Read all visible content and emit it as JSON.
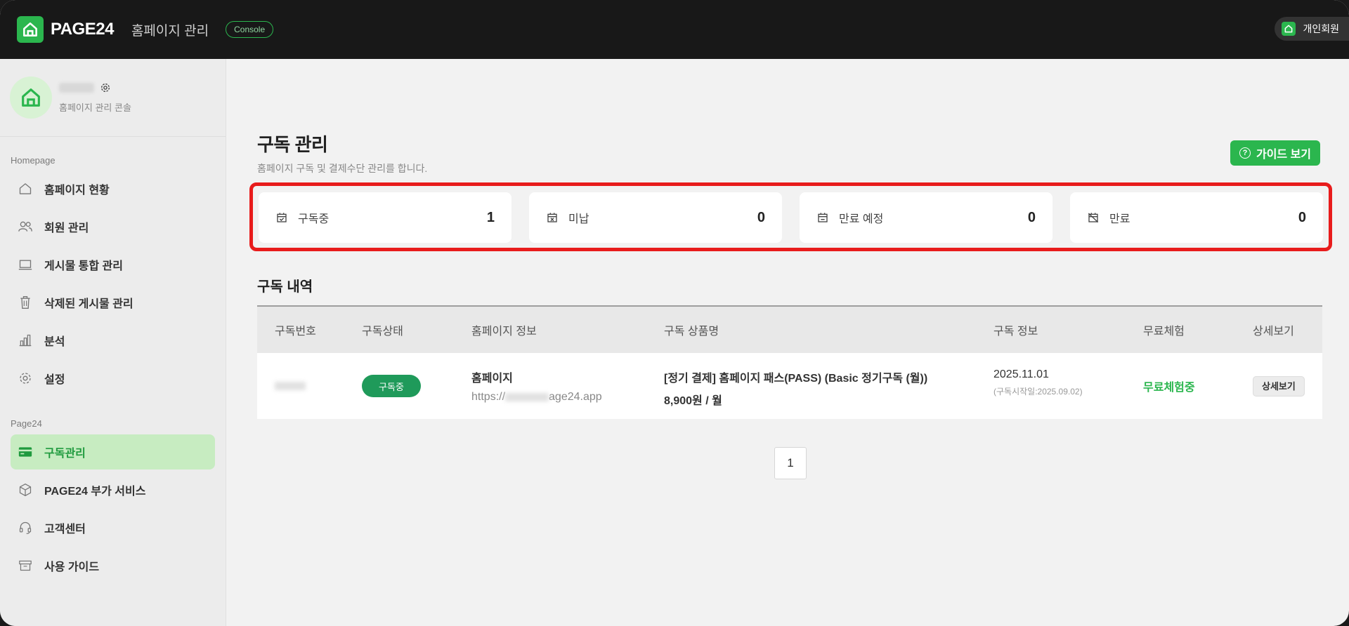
{
  "header": {
    "brand": "PAGE24",
    "app_title": "홈페이지 관리",
    "console_badge": "Console",
    "user_chip": "개인회원"
  },
  "sidebar": {
    "profile_subtitle": "홈페이지 관리 콘솔",
    "sections": [
      {
        "label": "Homepage",
        "items": [
          {
            "label": "홈페이지 현황",
            "icon": "home-icon"
          },
          {
            "label": "회원 관리",
            "icon": "users-icon"
          },
          {
            "label": "게시물 통합 관리",
            "icon": "laptop-icon"
          },
          {
            "label": "삭제된 게시물 관리",
            "icon": "trash-icon"
          },
          {
            "label": "분석",
            "icon": "bar-chart-icon"
          },
          {
            "label": "설정",
            "icon": "gear-icon"
          }
        ]
      },
      {
        "label": "Page24",
        "items": [
          {
            "label": "구독관리",
            "icon": "card-icon",
            "active": true
          },
          {
            "label": "PAGE24 부가 서비스",
            "icon": "box-icon"
          },
          {
            "label": "고객센터",
            "icon": "headset-icon"
          },
          {
            "label": "사용 가이드",
            "icon": "archive-icon"
          }
        ]
      }
    ]
  },
  "page": {
    "title": "구독 관리",
    "subtitle": "홈페이지 구독 및 결제수단 관리를 합니다.",
    "guide_button": "가이드 보기"
  },
  "stats": [
    {
      "label": "구독중",
      "value": "1",
      "icon": "calendar-check-icon"
    },
    {
      "label": "미납",
      "value": "0",
      "icon": "calendar-x-icon"
    },
    {
      "label": "만료 예정",
      "value": "0",
      "icon": "calendar-minus-icon"
    },
    {
      "label": "만료",
      "value": "0",
      "icon": "calendar-off-icon"
    }
  ],
  "history": {
    "title": "구독 내역",
    "columns": [
      "구독번호",
      "구독상태",
      "홈페이지 정보",
      "구독 상품명",
      "구독 정보",
      "무료체험",
      "상세보기"
    ],
    "rows": [
      {
        "status": "구독중",
        "homepage_name": "홈페이지",
        "url_prefix": "https://",
        "url_suffix": "age24.app",
        "product_name": "[정기 결제] 홈페이지 패스(PASS) (Basic 정기구독 (월))",
        "price": "8,900원 / 월",
        "date": "2025.11.01",
        "start_note": "(구독시작일:2025.09.02)",
        "free_trial": "무료체험중",
        "detail_button": "상세보기"
      }
    ]
  },
  "pagination": {
    "current": "1"
  },
  "colors": {
    "accent": "#2bb64e",
    "highlight_border": "#e81c1c",
    "topbar": "#181818"
  }
}
